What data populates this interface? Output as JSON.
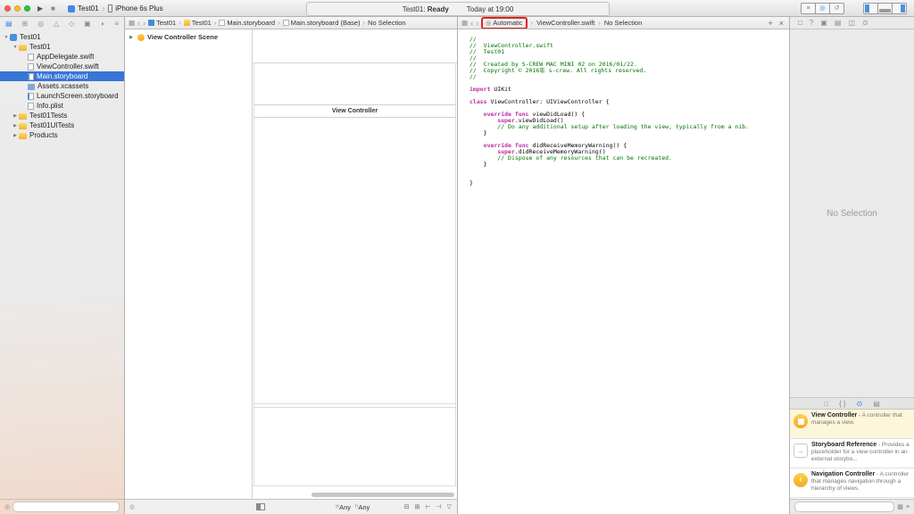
{
  "toolbar": {
    "scheme_name": "Test01",
    "scheme_device": "iPhone 6s Plus",
    "status_project": "Test01:",
    "status_state": "Ready",
    "status_time": "Today at 19:00",
    "editor_buttons": [
      {
        "name": "standard-editor",
        "active": false
      },
      {
        "name": "assistant-editor",
        "active": true
      },
      {
        "name": "version-editor",
        "active": false
      }
    ],
    "view_buttons": [
      {
        "name": "navigator-panel",
        "active": true
      },
      {
        "name": "debug-area",
        "active": false
      },
      {
        "name": "utilities-panel",
        "active": true
      }
    ]
  },
  "navigator": {
    "tabs": [
      {
        "name": "project-navigator",
        "active": true
      },
      {
        "name": "symbol-navigator",
        "active": false
      },
      {
        "name": "find-navigator",
        "active": false
      },
      {
        "name": "issue-navigator",
        "active": false
      },
      {
        "name": "test-navigator",
        "active": false
      },
      {
        "name": "debug-navigator",
        "active": false
      },
      {
        "name": "breakpoint-navigator",
        "active": false
      },
      {
        "name": "report-navigator",
        "active": false
      }
    ],
    "tree": [
      {
        "label": "Test01",
        "level": 0,
        "icon": "project",
        "disclosure": "open",
        "selected": false
      },
      {
        "label": "Test01",
        "level": 1,
        "icon": "folder",
        "disclosure": "open",
        "selected": false
      },
      {
        "label": "AppDelegate.swift",
        "level": 2,
        "icon": "swift",
        "disclosure": "none",
        "selected": false
      },
      {
        "label": "ViewController.swift",
        "level": 2,
        "icon": "swift",
        "disclosure": "none",
        "selected": false
      },
      {
        "label": "Main.storyboard",
        "level": 2,
        "icon": "storyboard",
        "disclosure": "none",
        "selected": true
      },
      {
        "label": "Assets.xcassets",
        "level": 2,
        "icon": "assets",
        "disclosure": "none",
        "selected": false
      },
      {
        "label": "LaunchScreen.storyboard",
        "level": 2,
        "icon": "storyboard",
        "disclosure": "none",
        "selected": false
      },
      {
        "label": "Info.plist",
        "level": 2,
        "icon": "plist",
        "disclosure": "none",
        "selected": false
      },
      {
        "label": "Test01Tests",
        "level": 1,
        "icon": "folder",
        "disclosure": "closed",
        "selected": false
      },
      {
        "label": "Test01UITests",
        "level": 1,
        "icon": "folder",
        "disclosure": "closed",
        "selected": false
      },
      {
        "label": "Products",
        "level": 1,
        "icon": "folder",
        "disclosure": "closed",
        "selected": false
      }
    ]
  },
  "storyboard_editor": {
    "breadcrumbs": [
      {
        "label": "Test01",
        "icon": "project"
      },
      {
        "label": "Test01",
        "icon": "folder"
      },
      {
        "label": "Main.storyboard",
        "icon": "storyboard"
      },
      {
        "label": "Main.storyboard (Base)",
        "icon": "storyboard"
      },
      {
        "label": "No Selection",
        "icon": "none"
      }
    ],
    "outline_header": "View Controller Scene",
    "scene_title": "View Controller",
    "traits": {
      "w_label": "w",
      "w_value": "Any",
      "h_label": "h",
      "h_value": "Any"
    },
    "bottom_icons": [
      "embed-in-stack",
      "embed-in",
      "align",
      "pin",
      "resolve-auto-layout"
    ]
  },
  "assistant_editor": {
    "mode_label": "Automatic",
    "breadcrumbs": [
      "ViewController.swift",
      "No Selection"
    ],
    "add_label": "+",
    "close_label": "×",
    "code_lines": [
      [
        [
          "//",
          "c"
        ]
      ],
      [
        [
          "//  ViewController.swift",
          "c"
        ]
      ],
      [
        [
          "//  Test01",
          "c"
        ]
      ],
      [
        [
          "//",
          "c"
        ]
      ],
      [
        [
          "//  Created by S-CREW MAC MINI 02 on 2016/01/22.",
          "c"
        ]
      ],
      [
        [
          "//  Copyright © 2016年 s-crew. All rights reserved.",
          "c"
        ]
      ],
      [
        [
          "//",
          "c"
        ]
      ],
      [],
      [
        [
          "import",
          "k"
        ],
        [
          " UIKit",
          "p"
        ]
      ],
      [],
      [
        [
          "class",
          "k"
        ],
        [
          " ViewController: UIViewController {",
          "p"
        ]
      ],
      [],
      [
        [
          "    ",
          "p"
        ],
        [
          "override",
          "k"
        ],
        [
          " ",
          "p"
        ],
        [
          "func",
          "k"
        ],
        [
          " viewDidLoad() {",
          "p"
        ]
      ],
      [
        [
          "        ",
          "p"
        ],
        [
          "super",
          "k"
        ],
        [
          ".viewDidLoad()",
          "p"
        ]
      ],
      [
        [
          "        // Do any additional setup after loading the view, typically from a nib.",
          "c"
        ]
      ],
      [
        [
          "    }",
          "p"
        ]
      ],
      [],
      [
        [
          "    ",
          "p"
        ],
        [
          "override",
          "k"
        ],
        [
          " ",
          "p"
        ],
        [
          "func",
          "k"
        ],
        [
          " didReceiveMemoryWarning() {",
          "p"
        ]
      ],
      [
        [
          "        ",
          "p"
        ],
        [
          "super",
          "k"
        ],
        [
          ".didReceiveMemoryWarning()",
          "p"
        ]
      ],
      [
        [
          "        // Dispose of any resources that can be recreated.",
          "c"
        ]
      ],
      [
        [
          "    }",
          "p"
        ]
      ],
      [],
      [],
      [
        [
          "}",
          "p"
        ]
      ]
    ]
  },
  "utilities": {
    "inspector_tabs": [
      {
        "name": "file-inspector",
        "active": true
      },
      {
        "name": "quick-help-inspector",
        "active": false
      },
      {
        "name": "identity-inspector",
        "active": false
      },
      {
        "name": "attributes-inspector",
        "active": false
      },
      {
        "name": "size-inspector",
        "active": false
      },
      {
        "name": "connections-inspector",
        "active": false
      }
    ],
    "no_selection_label": "No Selection",
    "library_tabs": [
      {
        "name": "file-template-library",
        "active": false
      },
      {
        "name": "code-snippet-library",
        "active": false
      },
      {
        "name": "object-library",
        "active": true
      },
      {
        "name": "media-library",
        "active": false
      }
    ],
    "library_items": [
      {
        "title": "View Controller",
        "desc": "A controller that manages a view.",
        "icon": "view-controller-icon",
        "selected": true
      },
      {
        "title": "Storyboard Reference",
        "desc": "Provides a placeholder for a view controller in an external storybo...",
        "icon": "storyboard-reference-icon",
        "selected": false
      },
      {
        "title": "Navigation Controller",
        "desc": "A controller that manages navigation through a hierarchy of views.",
        "icon": "navigation-controller-icon",
        "selected": false
      }
    ]
  }
}
